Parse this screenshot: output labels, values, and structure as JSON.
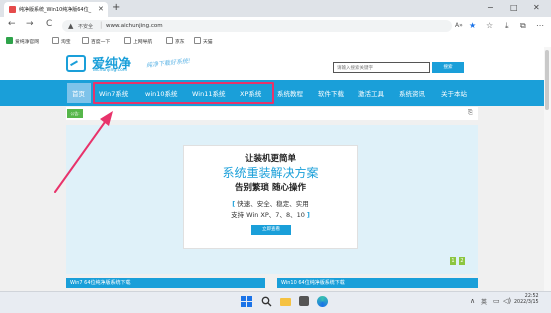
{
  "browser": {
    "tab_title": "纯净版系统_Win10纯净版64位_",
    "tab_close": "✕",
    "new_tab": "+",
    "window_controls": {
      "minimize": "−",
      "maximize": "□",
      "close": "✕"
    },
    "nav": {
      "back": "←",
      "forward": "→",
      "refresh": "C"
    },
    "security_label": "不安全",
    "url": "www.aichunjing.com",
    "toolbar_icons": [
      "read-aloud-icon",
      "star-icon",
      "favorites-icon",
      "download-icon",
      "extensions-icon",
      "menu-icon"
    ]
  },
  "favorites": [
    {
      "label": "爱纯净官网",
      "icon": "site-icon"
    },
    {
      "label": "淘宝",
      "icon": "page-icon"
    },
    {
      "label": "百度一下",
      "icon": "page-icon"
    },
    {
      "label": "上网导航",
      "icon": "page-icon"
    },
    {
      "label": "京东",
      "icon": "page-icon"
    },
    {
      "label": "天猫",
      "icon": "page-icon"
    }
  ],
  "site": {
    "logo_text": "爱纯净",
    "logo_domain": "aichunjing.com",
    "slogan": "纯净下载好系统!",
    "search_placeholder": "请输入搜索关键字",
    "search_button": "搜索",
    "nav": [
      "首页",
      "Win7系统",
      "win10系统",
      "Win11系统",
      "XP系统",
      "系统教程",
      "软件下载",
      "激活工具",
      "系统资讯",
      "关于本站"
    ],
    "nav_active": "首页",
    "highlighted_items": [
      "Win7系统",
      "win10系统",
      "Win11系统",
      "XP系统"
    ],
    "notice_label": "公告:",
    "notice_icon": "document-icon",
    "banner": {
      "line1": "让装机更简单",
      "line2": "系统重装解决方案",
      "line3": "告别繁琐 随心操作",
      "line4_open": "[",
      "line4": " 快速、安全、稳定、实用",
      "line5": "支持 Win XP、7、8、10 ",
      "line5_close": "]",
      "button": "立即查看"
    },
    "slide_dots": [
      "1",
      "2"
    ],
    "sections": [
      "Win7 64位纯净版系统下载",
      "Win10 64位纯净版系统下载"
    ]
  },
  "taskbar": {
    "apps": [
      "windows-start-icon",
      "search-icon",
      "file-explorer-icon",
      "store-icon",
      "edge-icon"
    ],
    "tray": {
      "lang": "英",
      "time": "22:52",
      "date": "2022/3/15"
    }
  },
  "colors": {
    "accent": "#1a9fd9",
    "highlight": "#e8336b",
    "notice_green": "#56b64a"
  }
}
